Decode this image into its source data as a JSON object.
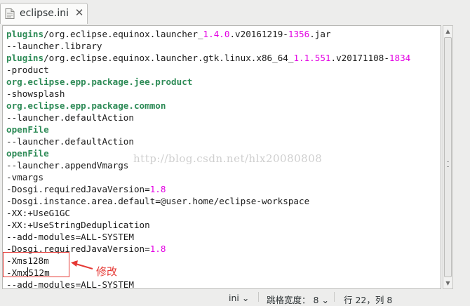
{
  "tab": {
    "title": "eclipse.ini",
    "close_glyph": "✕",
    "icon": "document-icon"
  },
  "editor": {
    "lines": [
      [
        {
          "t": "plugins",
          "c": "kw"
        },
        {
          "t": "/org.eclipse.equinox.launcher_"
        },
        {
          "t": "1.4.0",
          "c": "num"
        },
        {
          "t": ".v20161219-"
        },
        {
          "t": "1356",
          "c": "num"
        },
        {
          "t": ".jar"
        }
      ],
      [
        {
          "t": "--launcher.library"
        }
      ],
      [
        {
          "t": "plugins",
          "c": "kw"
        },
        {
          "t": "/org.eclipse.equinox.launcher.gtk.linux.x86_64_"
        },
        {
          "t": "1.1.551",
          "c": "num"
        },
        {
          "t": ".v20171108-"
        },
        {
          "t": "1834",
          "c": "num"
        }
      ],
      [
        {
          "t": "-product"
        }
      ],
      [
        {
          "t": "org.eclipse.epp.package.jee.product",
          "c": "kw"
        }
      ],
      [
        {
          "t": "-showsplash"
        }
      ],
      [
        {
          "t": "org.eclipse.epp.package.common",
          "c": "kw"
        }
      ],
      [
        {
          "t": "--launcher.defaultAction"
        }
      ],
      [
        {
          "t": "openFile",
          "c": "kw"
        }
      ],
      [
        {
          "t": "--launcher.defaultAction"
        }
      ],
      [
        {
          "t": "openFile",
          "c": "kw"
        }
      ],
      [
        {
          "t": "--launcher.appendVmargs"
        }
      ],
      [
        {
          "t": "-vmargs"
        }
      ],
      [
        {
          "t": "-Dosgi.requiredJavaVersion="
        },
        {
          "t": "1.8",
          "c": "num"
        }
      ],
      [
        {
          "t": "-Dosgi.instance.area.default=@user.home/eclipse-workspace"
        }
      ],
      [
        {
          "t": "-XX:+UseG1GC"
        }
      ],
      [
        {
          "t": "-XX:+UseStringDeduplication"
        }
      ],
      [
        {
          "t": "--add-modules=ALL-SYSTEM"
        }
      ],
      [
        {
          "t": "-Dosgi.requiredJavaVersion="
        },
        {
          "t": "1.8",
          "c": "num"
        }
      ],
      [
        {
          "t": "-Xms128m"
        }
      ],
      [
        {
          "t": "-Xmx512m",
          "cursor_after": 4
        }
      ],
      [
        {
          "t": "--add-modules=ALL-SYSTEM"
        }
      ]
    ],
    "watermark": "http://blog.csdn.net/hlx20080808",
    "annotation": "修改",
    "colors": {
      "keyword": "#2e8b57",
      "number": "#e300e3",
      "annotation": "#e53935"
    }
  },
  "statusbar": {
    "syntax": "ini",
    "tab_width_label": "跳格宽度：",
    "tab_width_value": "8",
    "position": "行 22，列 8"
  }
}
